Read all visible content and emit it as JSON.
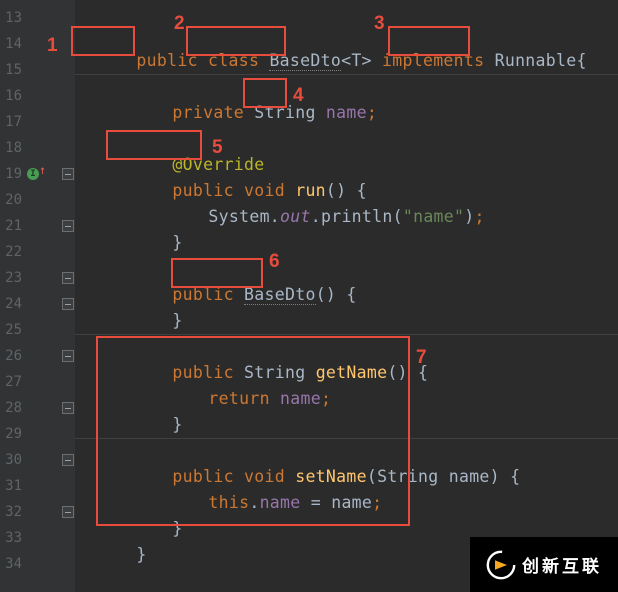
{
  "line_numbers": [
    "13",
    "14",
    "15",
    "16",
    "17",
    "18",
    "19",
    "20",
    "21",
    "22",
    "23",
    "24",
    "25",
    "26",
    "27",
    "28",
    "29",
    "30",
    "31",
    "32",
    "33",
    "34"
  ],
  "callouts": {
    "c1": "1",
    "c2": "2",
    "c3": "3",
    "c4": "4",
    "c5": "5",
    "c6": "6",
    "c7": "7"
  },
  "logo_text": "创新互联",
  "code": {
    "l14": {
      "public": "public",
      "class": "class",
      "base": "BaseDto",
      "gen": "<T>",
      "implements": "implements",
      "runnable": "Runnable",
      "brace": "{"
    },
    "l16": {
      "private": "private",
      "string": "String",
      "name": "name",
      "semi": ";"
    },
    "l18": {
      "override": "@Override"
    },
    "l19": {
      "public": "public",
      "void": "void",
      "run": "run",
      "parens": "()",
      "brace": "{"
    },
    "l20": {
      "system": "System.",
      "out": "out",
      "dot": ".",
      "println": "println",
      "op": "(",
      "q1": "\"",
      "txt": "name",
      "q2": "\"",
      "cp": ")",
      "semi": ";"
    },
    "l21": {
      "brace": "}"
    },
    "l23": {
      "public": "public",
      "base": "BaseDto",
      "parens": "()",
      "brace": "{"
    },
    "l24": {
      "brace": "}"
    },
    "l26": {
      "public": "public",
      "string": "String",
      "getname": "getName",
      "parens": "()",
      "brace": "{"
    },
    "l27": {
      "return": "return",
      "name": "name",
      "semi": ";"
    },
    "l28": {
      "brace": "}"
    },
    "l30": {
      "public": "public",
      "void": "void",
      "setname": "setName",
      "op": "(",
      "string": "String",
      "arg": "name",
      "cp": ")",
      "brace": "{"
    },
    "l31": {
      "this": "this",
      "dot": ".",
      "name": "name",
      "eq": " = ",
      "arg": "name",
      "semi": ";"
    },
    "l32": {
      "brace": "}"
    },
    "l33": {
      "brace": "}"
    }
  }
}
